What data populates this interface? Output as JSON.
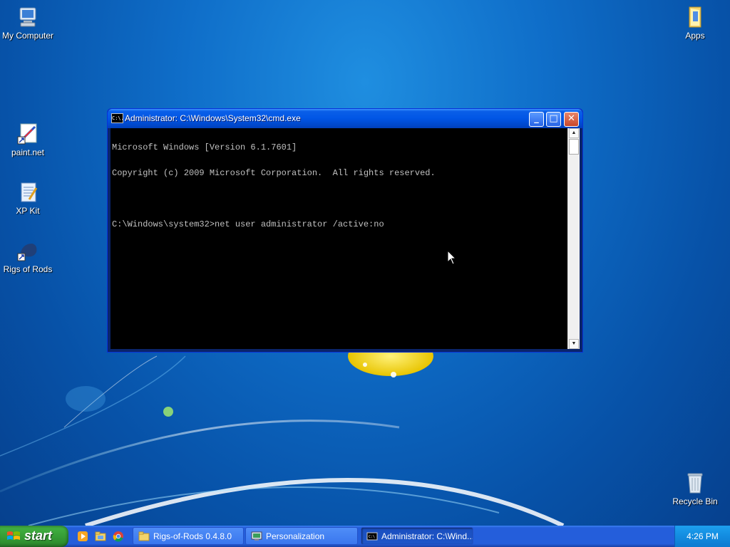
{
  "desktop": {
    "icons": {
      "my_computer": "My Computer",
      "apps": "Apps",
      "paint_net": "paint.net",
      "xp_kit": "XP Kit",
      "rigs_of_rods": "Rigs of Rods",
      "recycle_bin": "Recycle Bin"
    }
  },
  "cmd_window": {
    "title": "Administrator: C:\\Windows\\System32\\cmd.exe",
    "icon_text": "C:\\.",
    "minimize": "_",
    "maximize": "□",
    "close": "✕",
    "lines": [
      "Microsoft Windows [Version 6.1.7601]",
      "Copyright (c) 2009 Microsoft Corporation.  All rights reserved.",
      "",
      "C:\\Windows\\system32>net user administrator /active:no"
    ]
  },
  "taskbar": {
    "start_label": "start",
    "buttons": [
      {
        "label": "Rigs-of-Rods 0.4.8.0",
        "icon": "folder-icon"
      },
      {
        "label": "Personalization",
        "icon": "display-icon"
      },
      {
        "label": "Administrator: C:\\Wind...",
        "icon": "cmd-icon"
      }
    ],
    "clock": "4:26 PM"
  },
  "colors": {
    "desktop": "#0f6ec9",
    "taskbar": "#245edb",
    "start": "#3c9a3c",
    "titlebar": "#0055e5",
    "console_bg": "#000000",
    "console_fg": "#c0c0c0"
  }
}
